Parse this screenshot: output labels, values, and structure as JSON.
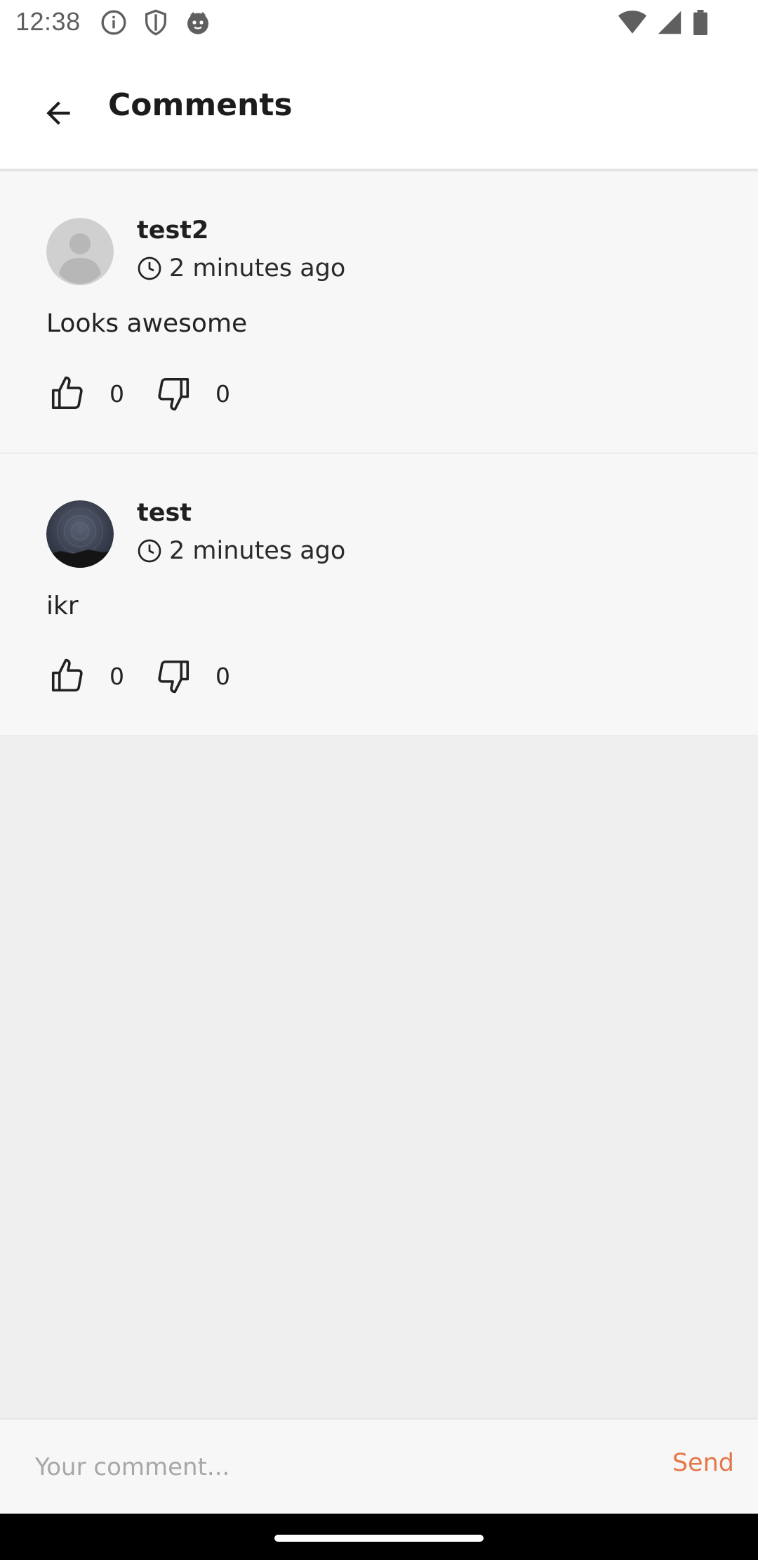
{
  "status_bar": {
    "time": "12:38",
    "left_icons": [
      "info-icon",
      "shield-icon",
      "cat-icon"
    ],
    "right_icons": [
      "wifi-icon",
      "signal-icon",
      "battery-icon"
    ]
  },
  "app_bar": {
    "title": "Comments",
    "back_icon": "arrow-back-icon"
  },
  "comments": [
    {
      "author": "test2",
      "time": "2 minutes ago",
      "text": "Looks awesome",
      "likes": "0",
      "dislikes": "0",
      "avatar": "default-avatar"
    },
    {
      "author": "test",
      "time": "2 minutes ago",
      "text": "ikr",
      "likes": "0",
      "dislikes": "0",
      "avatar": "night-sky-photo"
    }
  ],
  "composer": {
    "placeholder": "Your comment...",
    "send_label": "Send"
  },
  "colors": {
    "accent": "#e5774a",
    "card_background": "#f7f7f7",
    "page_background": "#efefef"
  }
}
